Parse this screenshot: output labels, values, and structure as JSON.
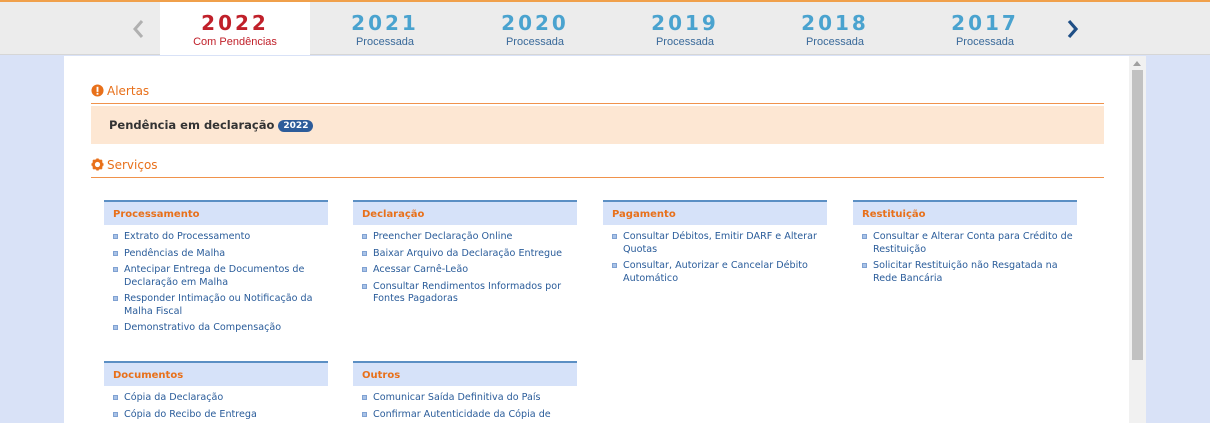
{
  "years": [
    {
      "year": "2022",
      "status": "Com Pendências",
      "active": true
    },
    {
      "year": "2021",
      "status": "Processada"
    },
    {
      "year": "2020",
      "status": "Processada"
    },
    {
      "year": "2019",
      "status": "Processada"
    },
    {
      "year": "2018",
      "status": "Processada"
    },
    {
      "year": "2017",
      "status": "Processada"
    }
  ],
  "alertas": {
    "title": "Alertas",
    "item": "Pendência em declaração",
    "badge": "2022"
  },
  "servicos": {
    "title": "Serviços",
    "cards": {
      "processamento": {
        "title": "Processamento",
        "items": [
          "Extrato do Processamento",
          "Pendências de Malha",
          "Antecipar Entrega de Documentos de Declaração em Malha",
          "Responder Intimação ou Notificação da Malha Fiscal",
          "Demonstrativo da Compensação"
        ]
      },
      "declaracao": {
        "title": "Declaração",
        "items": [
          "Preencher Declaração Online",
          "Baixar Arquivo da Declaração Entregue",
          "Acessar Carnê-Leão",
          "Consultar Rendimentos Informados por Fontes Pagadoras"
        ]
      },
      "pagamento": {
        "title": "Pagamento",
        "items": [
          "Consultar Débitos, Emitir DARF e Alterar Quotas",
          "Consultar, Autorizar e Cancelar Débito Automático"
        ]
      },
      "restituicao": {
        "title": "Restituição",
        "items": [
          "Consultar e Alterar Conta para Crédito de Restituição",
          "Solicitar Restituição não Resgatada na Rede Bancária"
        ]
      },
      "documentos": {
        "title": "Documentos",
        "items": [
          "Cópia da Declaração",
          "Cópia do Recibo de Entrega"
        ]
      },
      "outros": {
        "title": "Outros",
        "items": [
          "Comunicar Saída Definitiva do País",
          "Confirmar Autenticidade da Cópia de"
        ]
      }
    }
  },
  "colors": {
    "accent": "#e8701a",
    "active_year": "#c0202a",
    "year": "#4aa3cf",
    "link": "#2a5c9a"
  }
}
